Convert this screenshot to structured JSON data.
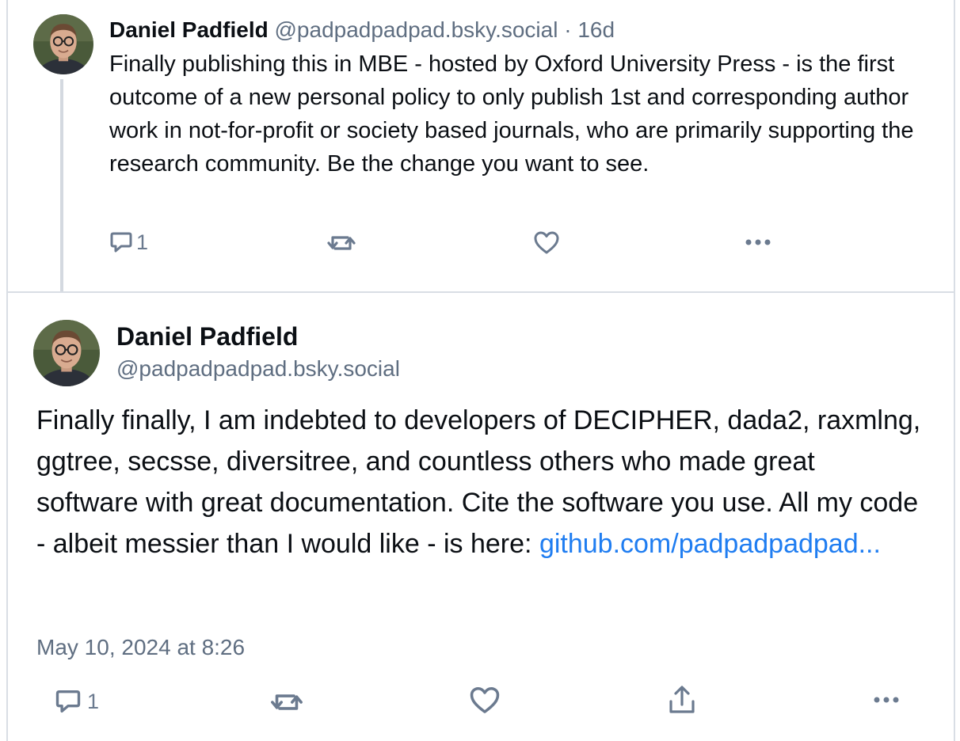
{
  "parent_post": {
    "author_name": "Daniel Padfield",
    "author_handle": "@padpadpadpad.bsky.social",
    "separator": "·",
    "age": "16d",
    "text": "Finally publishing this in MBE - hosted by Oxford University Press - is the first outcome of a new personal policy to only publish 1st and corresponding author work in not-for-profit or society based journals, who are primarily supporting the research community. Be the change you want to see.",
    "actions": {
      "reply_icon": "reply-icon",
      "reply_count": "1",
      "repost_icon": "repost-icon",
      "like_icon": "heart-icon",
      "more_icon": "more-icon"
    }
  },
  "main_post": {
    "author_name": "Daniel Padfield",
    "author_handle": "@padpadpadpad.bsky.social",
    "text_before_link": "Finally finally, I am indebted to developers of DECIPHER, dada2, raxmlng, ggtree, secsse, diversitree, and countless others who made great software with great documentation. Cite the software you use. All my code - albeit messier than I would like - is here: ",
    "link_text": "github.com/padpadpadpad...",
    "timestamp": "May 10, 2024 at 8:26",
    "actions": {
      "reply_icon": "reply-icon",
      "reply_count": "1",
      "repost_icon": "repost-icon",
      "like_icon": "heart-icon",
      "share_icon": "share-icon",
      "more_icon": "more-icon"
    }
  },
  "colors": {
    "link": "#1f7df1",
    "muted": "#5f6e81",
    "icon": "#6b7a8f",
    "border": "#d9dee5"
  }
}
